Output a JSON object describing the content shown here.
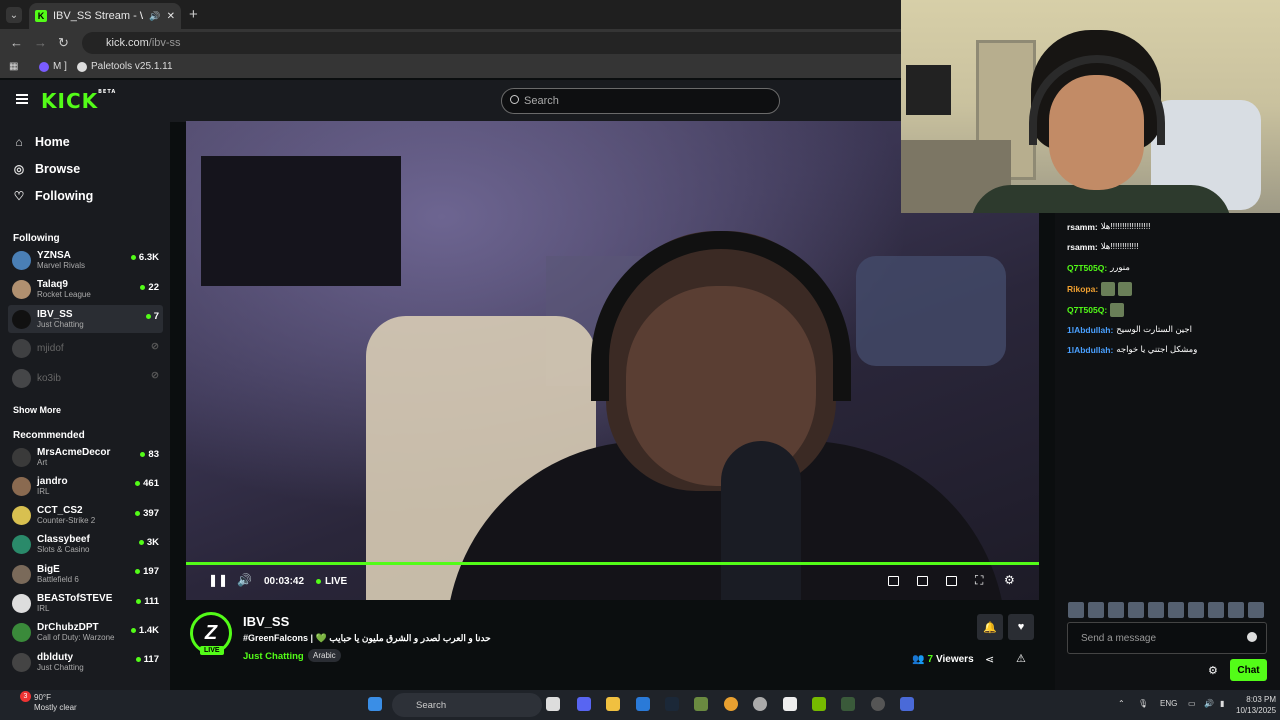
{
  "browser": {
    "tab_title": "IBV_SS Stream - Watch Live",
    "url_domain": "kick.com",
    "url_path": "/ibv-ss",
    "bookmarks": [
      "M ]",
      "Paletools v25.1.11"
    ]
  },
  "header": {
    "logo": "KICK",
    "logo_sup": "BETA",
    "search_placeholder": "Search"
  },
  "sidebar": {
    "nav": [
      {
        "label": "Home",
        "icon": "home-icon"
      },
      {
        "label": "Browse",
        "icon": "compass-icon"
      },
      {
        "label": "Following",
        "icon": "heart-icon"
      }
    ],
    "following_title": "Following",
    "following": [
      {
        "name": "YZNSA",
        "category": "Marvel Rivals",
        "viewers": "6.3K",
        "color": "#4a7fb5"
      },
      {
        "name": "Talaq9",
        "category": "Rocket League",
        "viewers": "22",
        "color": "#b09070"
      },
      {
        "name": "IBV_SS",
        "category": "Just Chatting",
        "viewers": "7",
        "color": "#111111"
      },
      {
        "name": "mjidof",
        "category": "",
        "viewers": "",
        "color": "#777"
      },
      {
        "name": "ko3ib",
        "category": "",
        "viewers": "",
        "color": "#888"
      }
    ],
    "show_more": "Show More",
    "recommended_title": "Recommended",
    "recommended": [
      {
        "name": "MrsAcmeDecor",
        "category": "Art",
        "viewers": "83",
        "color": "#3a3a3a"
      },
      {
        "name": "jandro",
        "category": "IRL",
        "viewers": "461",
        "color": "#8a6a50"
      },
      {
        "name": "CCT_CS2",
        "category": "Counter-Strike 2",
        "viewers": "397",
        "color": "#d8c050"
      },
      {
        "name": "Classybeef",
        "category": "Slots & Casino",
        "viewers": "3K",
        "color": "#2a8a6a"
      },
      {
        "name": "BigE",
        "category": "Battlefield 6",
        "viewers": "197",
        "color": "#7a6a5a"
      },
      {
        "name": "BEASTofSTEVE",
        "category": "IRL",
        "viewers": "111",
        "color": "#ddd"
      },
      {
        "name": "DrChubzDPT",
        "category": "Call of Duty: Warzone",
        "viewers": "1.4K",
        "color": "#3a8a3a"
      },
      {
        "name": "dblduty",
        "category": "Just Chatting",
        "viewers": "117",
        "color": "#444"
      }
    ]
  },
  "player": {
    "time": "00:03:42",
    "live_label": "LIVE"
  },
  "stream": {
    "channel": "IBV_SS",
    "avatar_letter": "Z",
    "live_badge": "LIVE",
    "title": "#GreenFalcons | 💚 حدنا و العرب لصدر و الشرق مليون يا حبايب",
    "category": "Just Chatting",
    "tag": "Arabic",
    "viewers_count": "7",
    "viewers_label": "Viewers"
  },
  "chat": {
    "messages": [
      {
        "user": "rsamm:",
        "text": "هلا!!!!!!!!!!!!!!!!!",
        "color": "#ffffff"
      },
      {
        "user": "rsamm:",
        "text": "هلا!!!!!!!!!!!!",
        "color": "#ffffff"
      },
      {
        "user": "Q7T505Q:",
        "text": "منورر",
        "color": "#53fc18"
      },
      {
        "user": "Rikopa:",
        "text": "",
        "color": "#f0a030",
        "emotes": 2
      },
      {
        "user": "Q7T505Q:",
        "text": "",
        "color": "#53fc18",
        "emotes": 1
      },
      {
        "user": "1lAbdullah:",
        "text": "اجين الستارت الوسيح",
        "color": "#4aa0ff"
      },
      {
        "user": "1lAbdullah:",
        "text": "ومشكل اجتني يا خواجه",
        "color": "#4aa0ff"
      }
    ],
    "input_placeholder": "Send a message",
    "send_label": "Chat"
  },
  "taskbar": {
    "weather_temp": "90°F",
    "weather_desc": "Mostly clear",
    "notif_count": "3",
    "search": "Search",
    "lang": "ENG",
    "time": "8:03 PM",
    "date": "10/13/2025"
  }
}
